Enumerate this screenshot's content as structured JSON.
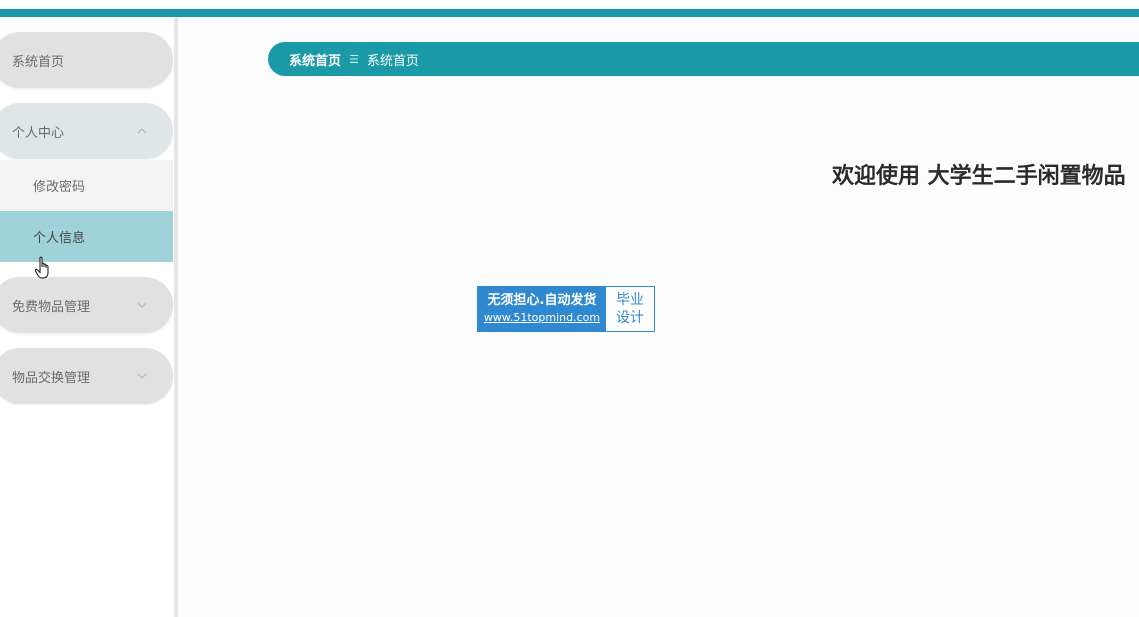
{
  "sidebar": {
    "items": [
      {
        "label": "系统首页"
      },
      {
        "label": "个人中心",
        "expanded": true,
        "children": [
          {
            "label": "修改密码"
          },
          {
            "label": "个人信息",
            "active": true
          }
        ]
      },
      {
        "label": "免费物品管理"
      },
      {
        "label": "物品交换管理"
      }
    ]
  },
  "breadcrumb": {
    "items": [
      "系统首页",
      "系统首页"
    ],
    "separator": "☰"
  },
  "welcome": {
    "text": "欢迎使用 大学生二手闲置物品"
  },
  "watermark": {
    "slogan": "无须担心.自动发货",
    "url": "www.51topmind.com",
    "badge_line1": "毕业",
    "badge_line2": "设计"
  },
  "colors": {
    "accent": "#1a9aa6",
    "active_item": "#9fd3d9",
    "pill": "#e1e1e1"
  },
  "icons": {
    "chevron_up": "chevron-up-icon",
    "chevron_down": "chevron-down-icon",
    "cursor": "hand-pointer-icon"
  }
}
